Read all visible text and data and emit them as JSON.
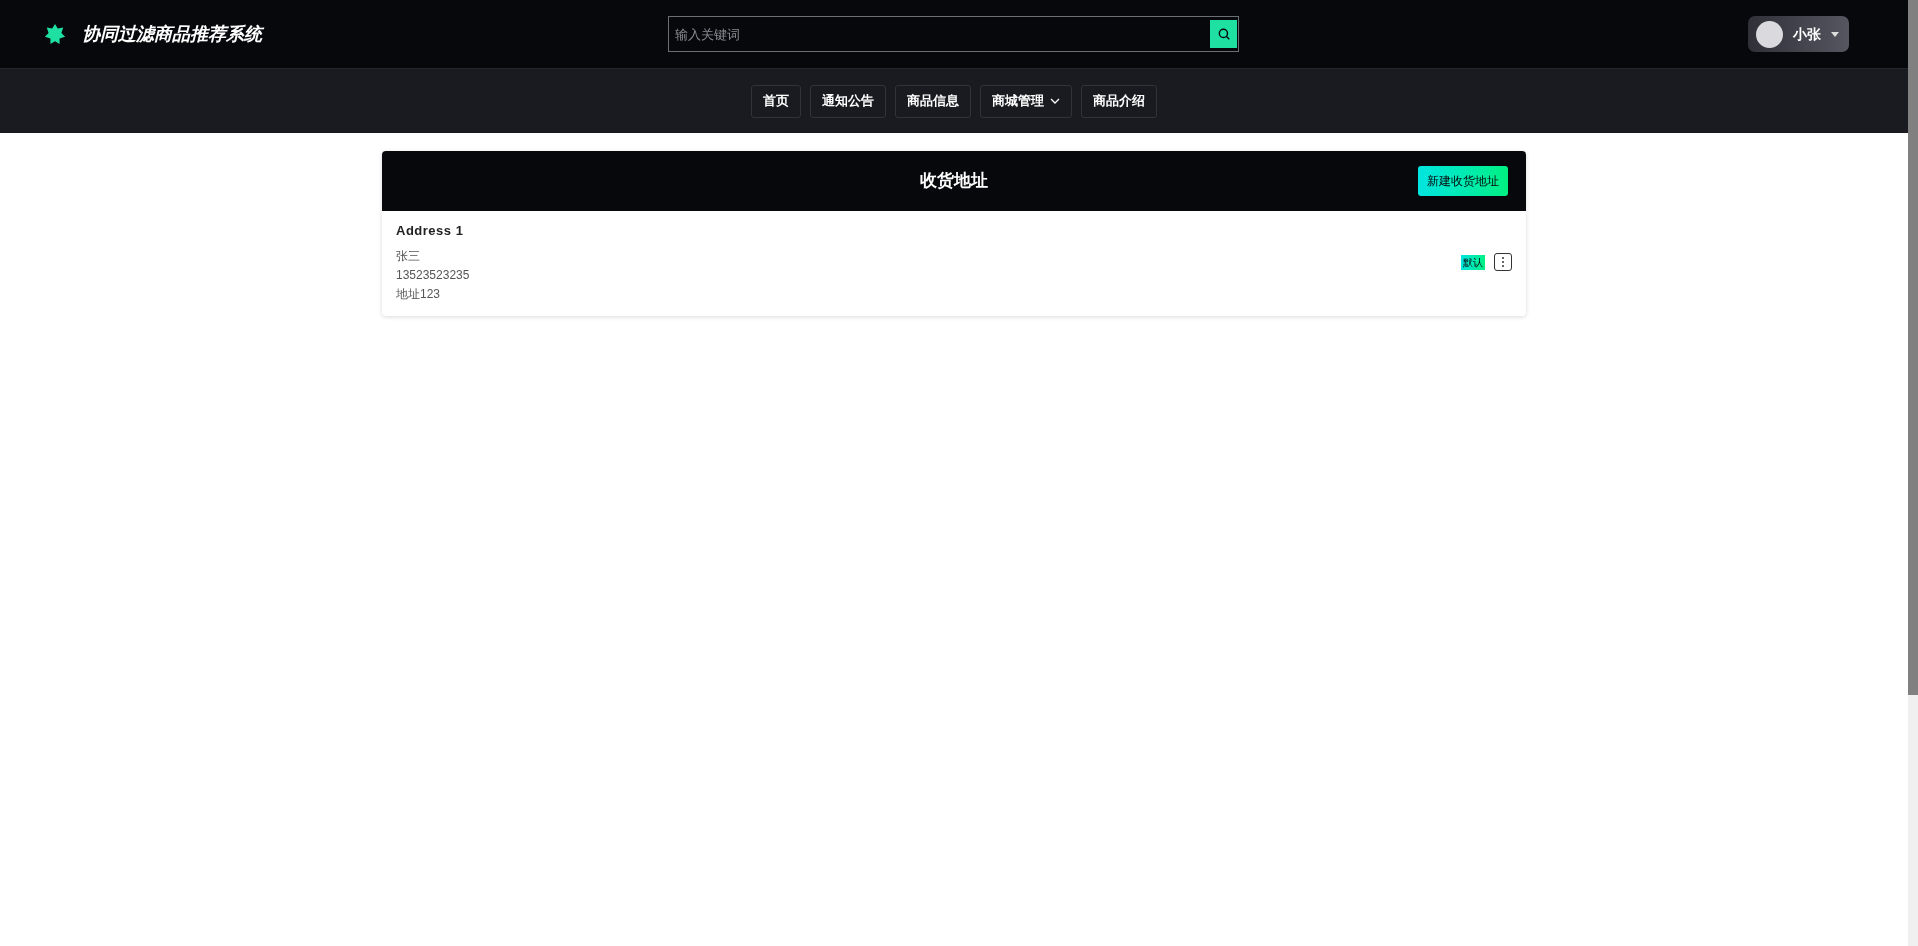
{
  "header": {
    "title": "协同过滤商品推荐系统",
    "search": {
      "placeholder": "输入关键词"
    },
    "user": {
      "name": "小张"
    }
  },
  "nav": [
    {
      "label": "首页",
      "kind": "link"
    },
    {
      "label": "通知公告",
      "kind": "link"
    },
    {
      "label": "商品信息",
      "kind": "link"
    },
    {
      "label": "商城管理",
      "kind": "dropdown"
    },
    {
      "label": "商品介绍",
      "kind": "link"
    }
  ],
  "panel": {
    "title": "收货地址",
    "new_button": "新建收货地址",
    "addresses": [
      {
        "title": "Address 1",
        "name": "张三",
        "phone": "13523523235",
        "address": "地址123",
        "badge": "默认"
      }
    ]
  }
}
